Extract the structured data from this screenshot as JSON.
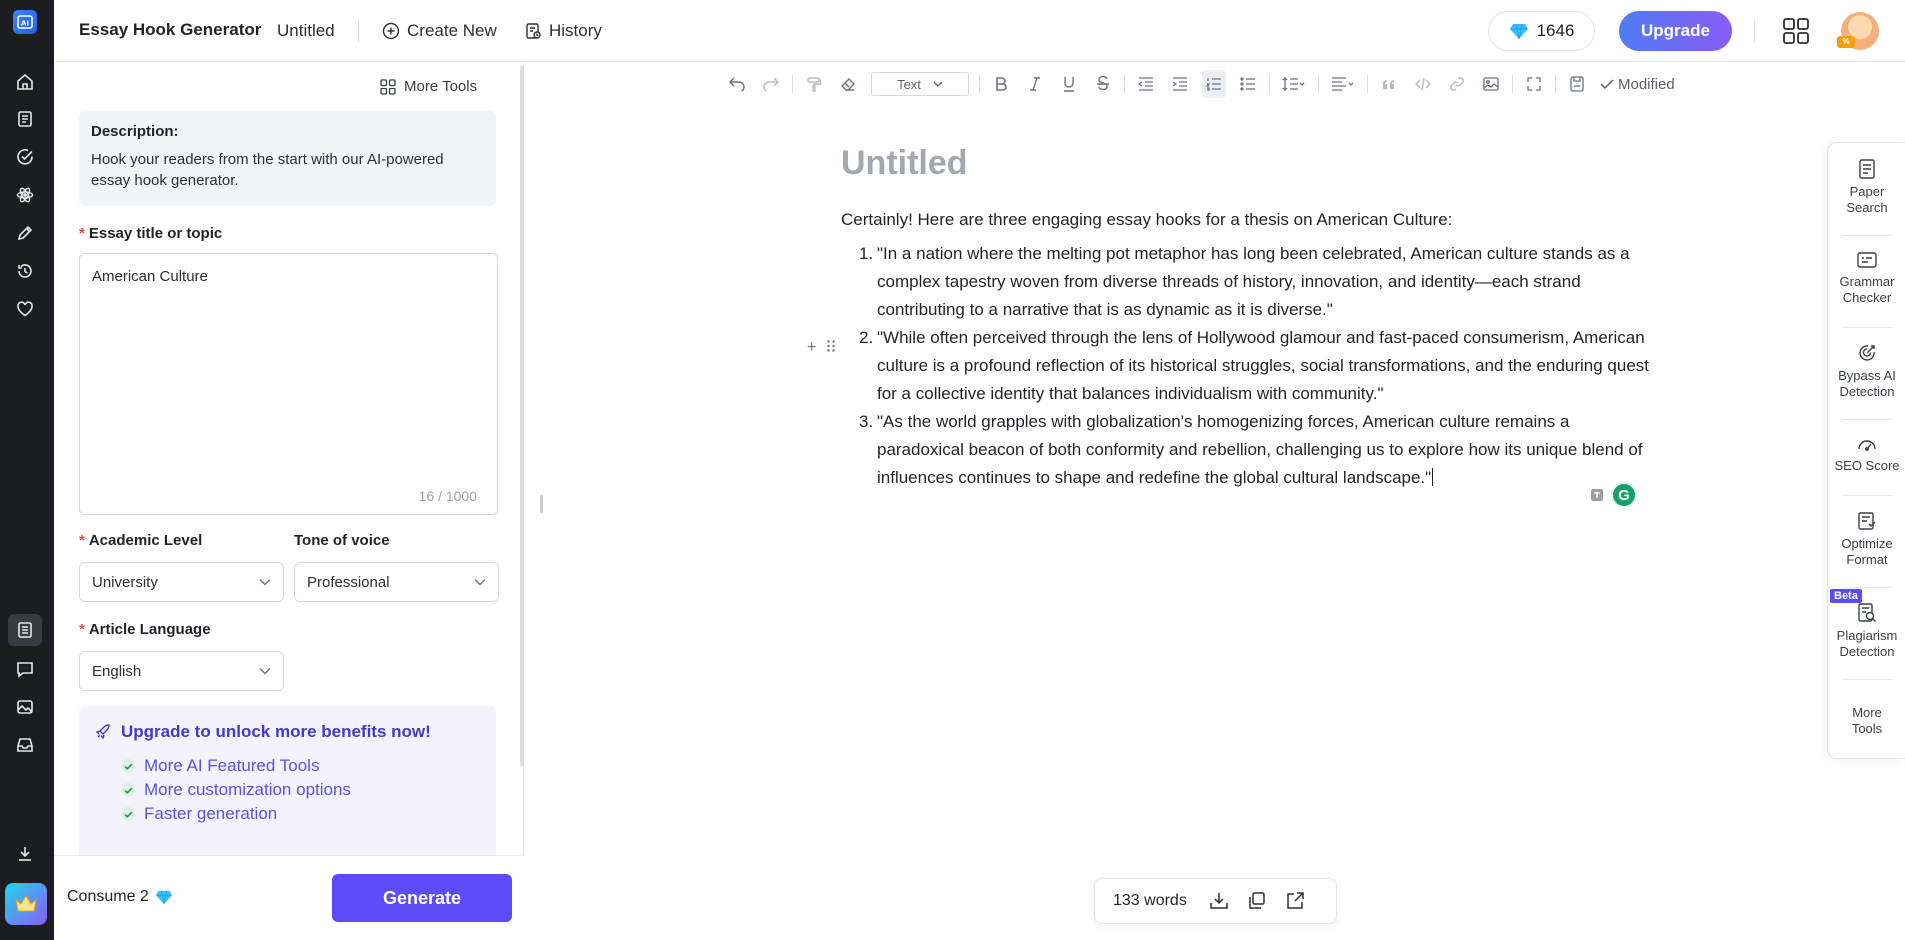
{
  "header": {
    "app_title": "Essay Hook Generator",
    "doc_name": "Untitled",
    "create_new": "Create New",
    "history": "History",
    "credits": "1646",
    "upgrade": "Upgrade",
    "avatar_badge": "%"
  },
  "panel": {
    "more_tools": "More Tools",
    "description_title": "Description:",
    "description_text": "Hook your readers from the start with our AI-powered essay hook generator.",
    "essay_label": "Essay title or topic",
    "essay_value": "American Culture",
    "essay_counter": "16 / 1000",
    "academic_label": "Academic Level",
    "academic_value": "University",
    "tone_label": "Tone of voice",
    "tone_value": "Professional",
    "language_label": "Article Language",
    "language_value": "English",
    "upgrade_title": "Upgrade to unlock more benefits now!",
    "benefits": [
      "More AI Featured Tools",
      "More customization options",
      "Faster generation"
    ],
    "consume": "Consume 2",
    "generate": "Generate"
  },
  "editor": {
    "text_style": "Text",
    "modified": "Modified",
    "title": "Untitled",
    "intro": "Certainly! Here are three engaging essay hooks for a thesis on American Culture:",
    "hooks": [
      {
        "num": "1.",
        "text": "\"In a nation where the melting pot metaphor has long been celebrated, American culture stands as a complex tapestry woven from diverse threads of history, innovation, and identity—each strand contributing to a narrative that is as dynamic as it is diverse.\""
      },
      {
        "num": "2.",
        "text": "\"While often perceived through the lens of Hollywood glamour and fast-paced consumerism, American culture is a profound reflection of its historical struggles, social transformations, and the enduring quest for a collective identity that balances individualism with community.\""
      },
      {
        "num": "3.",
        "text": "\"As the world grapples with globalization's homogenizing forces, American culture remains a paradoxical beacon of both conformity and rebellion, challenging us to explore how its unique blend of influences continues to shape and redefine the global cultural landscape.\""
      }
    ],
    "word_count": "133 words",
    "grammarly": "G"
  },
  "tools": {
    "paper_search": "Paper Search",
    "grammar_checker": "Grammar Checker",
    "bypass_ai": "Bypass AI Detection",
    "seo_score": "SEO Score",
    "optimize_format": "Optimize Format",
    "beta": "Beta",
    "plagiarism": "Plagiarism Detection",
    "more_tools": "More Tools"
  },
  "colors": {
    "rail": "#1c1d21",
    "accent": "#5b4cf5",
    "upgrade_gradient_start": "#4f7cf7",
    "upgrade_gradient_end": "#8b5cf6"
  }
}
